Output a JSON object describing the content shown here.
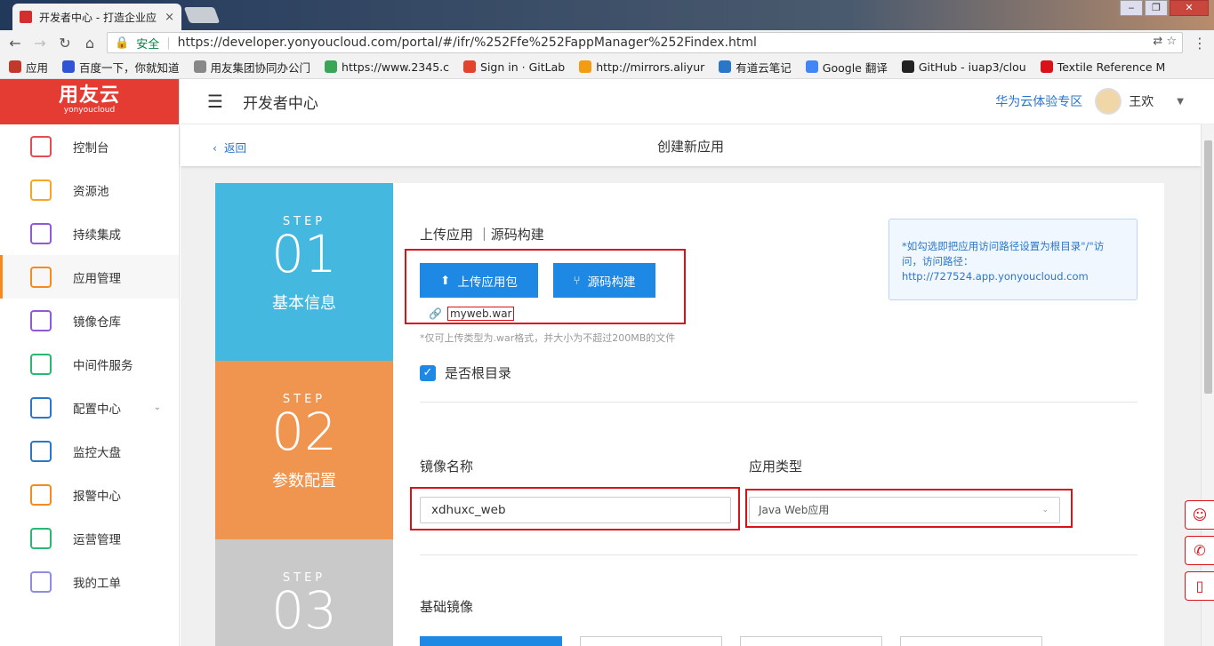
{
  "browser": {
    "tab_title": "开发者中心 - 打造企业应",
    "tab_close": "×",
    "window_buttons": [
      "‒",
      "❐",
      "✕"
    ],
    "secure_label": "安全",
    "url": "https://developer.yonyoucloud.com/portal/#/ifr/%252Ffe%252FappManager%252Findex.html",
    "bookmarks": [
      {
        "label": "应用",
        "color": "#c0392b"
      },
      {
        "label": "百度一下，你就知道",
        "color": "#2f55d4"
      },
      {
        "label": "用友集团协同办公门",
        "color": "#888888"
      },
      {
        "label": "https://www.2345.c",
        "color": "#3aa655"
      },
      {
        "label": "Sign in · GitLab",
        "color": "#e2432a"
      },
      {
        "label": "http://mirrors.aliyur",
        "color": "#f39c12"
      },
      {
        "label": "有道云笔记",
        "color": "#2a77c9"
      },
      {
        "label": "Google 翻译",
        "color": "#4285f4"
      },
      {
        "label": "GitHub - iuap3/clou",
        "color": "#222222"
      },
      {
        "label": "Textile Reference M",
        "color": "#d9121a"
      }
    ]
  },
  "brand": {
    "cn": "用友云",
    "en": "yonyoucloud"
  },
  "sidebar": {
    "items": [
      {
        "label": "控制台",
        "icon": "dashboard-icon",
        "color": "#e34c52"
      },
      {
        "label": "资源池",
        "icon": "inbox-icon",
        "color": "#f5a623"
      },
      {
        "label": "持续集成",
        "icon": "integration-icon",
        "color": "#8e5bd6"
      },
      {
        "label": "应用管理",
        "icon": "cubes-icon",
        "color": "#f58b1f"
      },
      {
        "label": "镜像仓库",
        "icon": "warehouse-icon",
        "color": "#8e5bd6"
      },
      {
        "label": "中间件服务",
        "icon": "database-icon",
        "color": "#2bb673"
      },
      {
        "label": "配置中心",
        "icon": "tools-icon",
        "color": "#2a77c9"
      },
      {
        "label": "监控大盘",
        "icon": "monitor-icon",
        "color": "#2a77c9"
      },
      {
        "label": "报警中心",
        "icon": "bell-icon",
        "color": "#f58b1f"
      },
      {
        "label": "运营管理",
        "icon": "chart-icon",
        "color": "#2bb673"
      },
      {
        "label": "我的工单",
        "icon": "document-icon",
        "color": "#8e8ee0"
      }
    ],
    "active_index": 3
  },
  "topbar": {
    "title": "开发者中心",
    "huawei_link": "华为云体验专区",
    "username": "王欢"
  },
  "subheader": {
    "back": "返回",
    "title": "创建新应用"
  },
  "steps": [
    {
      "label": "STEP",
      "num": "01",
      "name": "基本信息",
      "color": "#44b8de"
    },
    {
      "label": "STEP",
      "num": "02",
      "name": "参数配置",
      "color": "#f09550"
    },
    {
      "label": "STEP",
      "num": "03",
      "name": "",
      "color": "#c9c9c9"
    }
  ],
  "form": {
    "upload_label": "上传应用 ｜源码构建",
    "upload_button": "上传应用包",
    "source_button": "源码构建",
    "file_name": "myweb.war",
    "hint": "*仅可上传类型为.war格式，并大小为不超过200MB的文件",
    "info_text": "*如勾选即把应用访问路径设置为根目录\"/\"访问，访问路径：",
    "info_url": "http://727524.app.yonyoucloud.com",
    "root_checkbox": "是否根目录",
    "image_name_label": "镜像名称",
    "image_name_value": "xdhuxc_web",
    "app_type_label": "应用类型",
    "app_type_value": "Java Web应用",
    "base_image_label": "基础镜像"
  }
}
